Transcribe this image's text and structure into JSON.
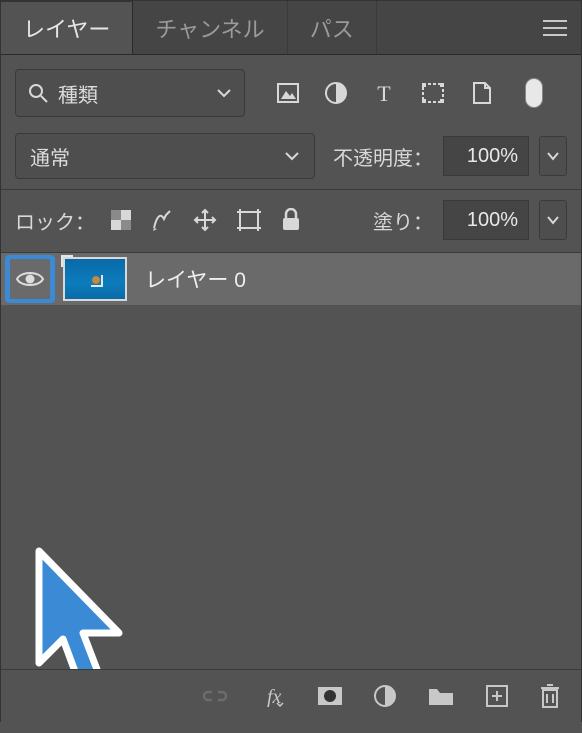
{
  "tabs": {
    "layers": "レイヤー",
    "channels": "チャンネル",
    "paths": "パス"
  },
  "filter": {
    "label": "種類"
  },
  "blend": {
    "label": "通常"
  },
  "opacity": {
    "label": "不透明度：",
    "value": "100%"
  },
  "lock": {
    "label": "ロック："
  },
  "fill": {
    "label": "塗り：",
    "value": "100%"
  },
  "layer0": {
    "name": "レイヤー 0"
  }
}
